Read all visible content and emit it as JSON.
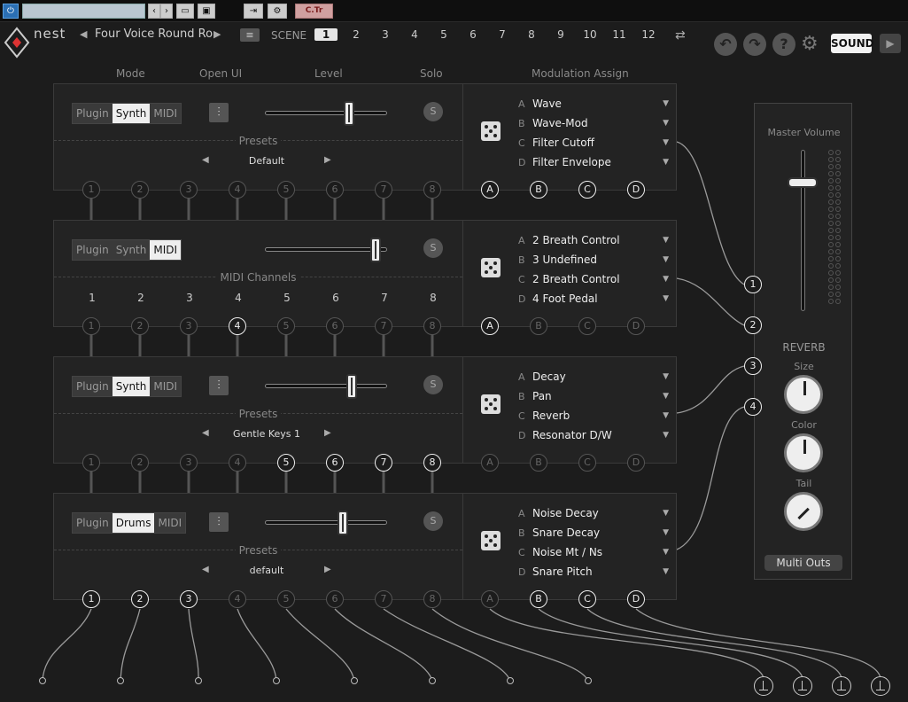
{
  "host": {
    "ctr_label": "C.Tr"
  },
  "header": {
    "logo": "nest",
    "preset_title": "Four Voice Round Ro",
    "scene_label": "SCENE",
    "scenes": [
      "1",
      "2",
      "3",
      "4",
      "5",
      "6",
      "7",
      "8",
      "9",
      "10",
      "11",
      "12"
    ],
    "active_scene": "1",
    "sound_button": "SOUND"
  },
  "columns": {
    "mode": "Mode",
    "open_ui": "Open UI",
    "level": "Level",
    "solo": "Solo",
    "modulation": "Modulation Assign"
  },
  "rows": [
    {
      "mode": [
        "Plugin",
        "Synth",
        "MIDI"
      ],
      "active": "Synth",
      "level": 0.68,
      "solo": "S",
      "section": "Presets",
      "preset": "Default",
      "mods": [
        [
          "A",
          "Wave"
        ],
        [
          "B",
          "Wave-Mod"
        ],
        [
          "C",
          "Filter Cutoff"
        ],
        [
          "D",
          "Filter Envelope"
        ]
      ]
    },
    {
      "mode": [
        "Plugin",
        "Synth",
        "MIDI"
      ],
      "active": "MIDI",
      "level": 0.9,
      "solo": "S",
      "section": "MIDI Channels",
      "channels": [
        "1",
        "2",
        "3",
        "4",
        "5",
        "6",
        "7",
        "8"
      ],
      "mods": [
        [
          "A",
          "2 Breath Control"
        ],
        [
          "B",
          "3 Undefined"
        ],
        [
          "C",
          "2 Breath Control"
        ],
        [
          "D",
          "4 Foot Pedal"
        ]
      ]
    },
    {
      "mode": [
        "Plugin",
        "Synth",
        "MIDI"
      ],
      "active": "Synth",
      "level": 0.7,
      "solo": "S",
      "section": "Presets",
      "preset": "Gentle Keys 1",
      "mods": [
        [
          "A",
          "Decay"
        ],
        [
          "B",
          "Pan"
        ],
        [
          "C",
          "Reverb"
        ],
        [
          "D",
          "Resonator D/W"
        ]
      ]
    },
    {
      "mode": [
        "Plugin",
        "Drums",
        "MIDI"
      ],
      "active": "Drums",
      "level": 0.63,
      "solo": "S",
      "section": "Presets",
      "preset": "default",
      "mods": [
        [
          "A",
          "Noise Decay"
        ],
        [
          "B",
          "Snare Decay"
        ],
        [
          "C",
          "Noise Mt / Ns"
        ],
        [
          "D",
          "Snare Pitch"
        ]
      ]
    }
  ],
  "ports": {
    "numbers": [
      "1",
      "2",
      "3",
      "4",
      "5",
      "6",
      "7",
      "8"
    ],
    "letters": [
      "A",
      "B",
      "C",
      "D"
    ]
  },
  "master": {
    "title": "Master Volume",
    "level": 0.8,
    "reverb": "REVERB",
    "size": "Size",
    "color": "Color",
    "tail": "Tail",
    "multi_outs": "Multi Outs",
    "buses": [
      "1",
      "2",
      "3",
      "4"
    ]
  }
}
